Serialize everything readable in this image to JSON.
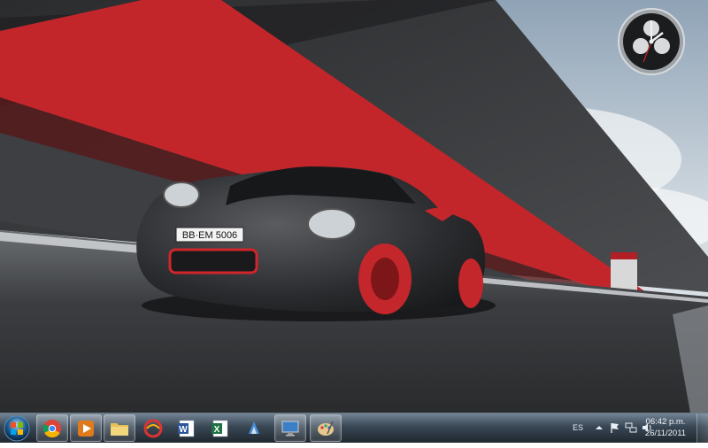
{
  "taskbar": {
    "pinned": [
      {
        "name": "chrome",
        "icon": "chrome-icon"
      },
      {
        "name": "media-player",
        "icon": "media-player-icon"
      },
      {
        "name": "explorer",
        "icon": "folder-icon"
      },
      {
        "name": "ccleaner",
        "icon": "ccleaner-icon"
      },
      {
        "name": "word",
        "icon": "word-icon"
      },
      {
        "name": "excel",
        "icon": "excel-icon"
      },
      {
        "name": "app-blue",
        "icon": "blue-app-icon"
      },
      {
        "name": "control-panel",
        "icon": "monitor-icon"
      },
      {
        "name": "paint",
        "icon": "paint-icon"
      }
    ]
  },
  "tray": {
    "language": "ES",
    "time": "06:42 p.m.",
    "date": "26/11/2011"
  },
  "wallpaper": {
    "plate": "BB·EM 5006"
  }
}
